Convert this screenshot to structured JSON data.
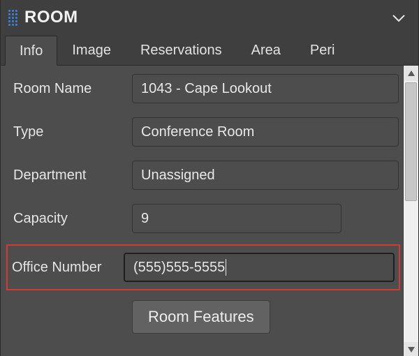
{
  "panel": {
    "title": "ROOM"
  },
  "tabs": {
    "items": [
      {
        "label": "Info"
      },
      {
        "label": "Image"
      },
      {
        "label": "Reservations"
      },
      {
        "label": "Area"
      },
      {
        "label": "Peri"
      }
    ],
    "active_index": 0
  },
  "form": {
    "room_name": {
      "label": "Room Name",
      "value": "1043 - Cape Lookout"
    },
    "type": {
      "label": "Type",
      "value": "Conference Room"
    },
    "department": {
      "label": "Department",
      "value": "Unassigned"
    },
    "capacity": {
      "label": "Capacity",
      "value": "9"
    },
    "office_number": {
      "label": "Office Number",
      "value": "(555)555-5555"
    },
    "features_button": "Room Features"
  }
}
